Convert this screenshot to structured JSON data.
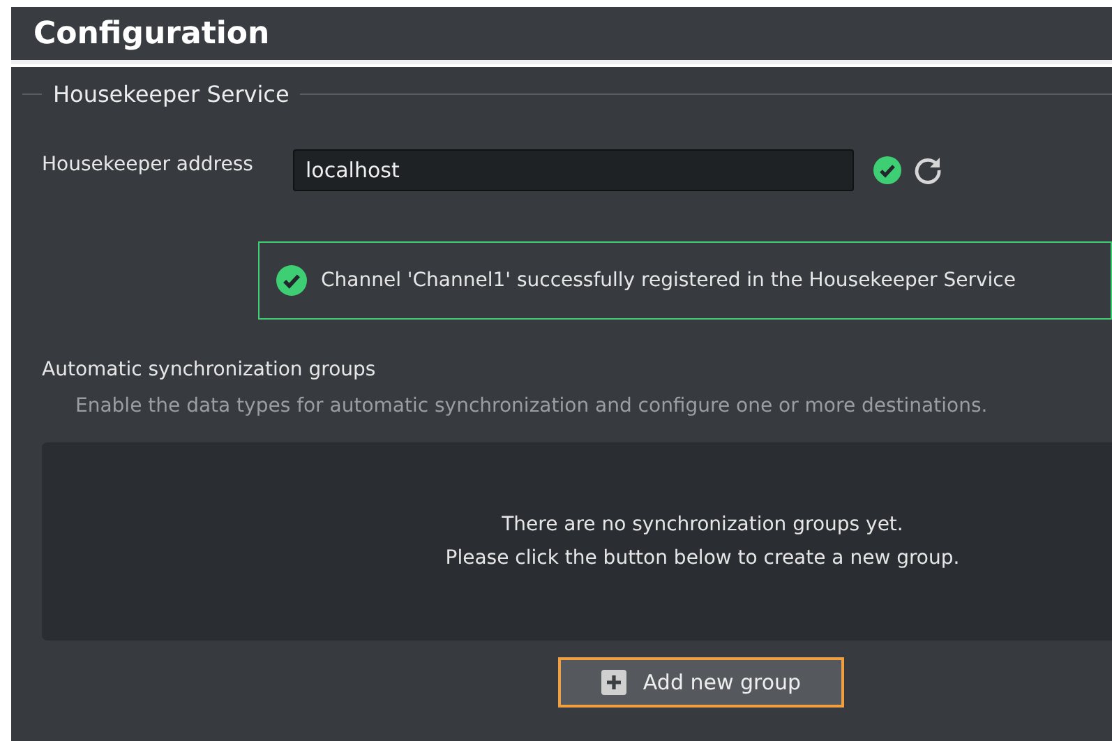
{
  "header": {
    "title": "Configuration"
  },
  "section": {
    "legend": "Housekeeper Service",
    "address": {
      "label": "Housekeeper address",
      "value": "localhost",
      "valid": true
    },
    "notice": {
      "kind": "success",
      "text": "Channel 'Channel1' successfully registered in the Housekeeper Service"
    }
  },
  "sync": {
    "title": "Automatic synchronization groups",
    "description": "Enable the data types for automatic synchronization and configure one or more destinations.",
    "empty_lines": [
      "There are no synchronization groups yet.",
      "Please click the button below to create a new group."
    ],
    "button": {
      "label": "Add new group",
      "focused": true
    }
  }
}
